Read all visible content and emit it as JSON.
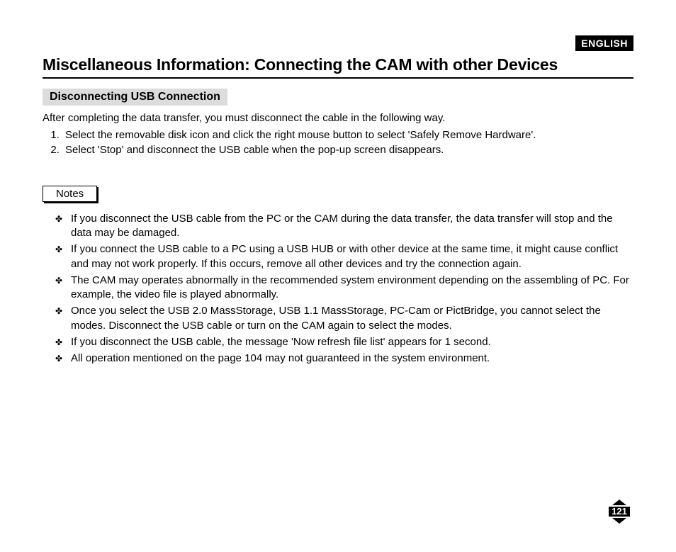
{
  "language_badge": "ENGLISH",
  "title": "Miscellaneous Information: Connecting the CAM with other Devices",
  "section_heading": "Disconnecting USB Connection",
  "intro": "After completing the data transfer, you must disconnect the cable in the following way.",
  "steps": [
    "Select the removable disk icon and click the right mouse button to select 'Safely Remove Hardware'.",
    "Select 'Stop' and disconnect the USB cable when the pop-up screen disappears."
  ],
  "notes_label": "Notes",
  "notes": [
    "If you disconnect the USB cable from the PC or the CAM during the data transfer, the data transfer will stop and the data may be damaged.",
    "If you connect the USB cable to a PC using a USB HUB or with other device at the same time, it might cause conflict and may not work properly. If this occurs, remove all other devices and try the connection again.",
    "The CAM may operates abnormally in the recommended system environment depending on the assembling of PC. For example, the video file is played abnormally.",
    "Once you select the USB 2.0 MassStorage, USB 1.1 MassStorage, PC-Cam or PictBridge, you cannot select the modes. Disconnect the USB cable or turn on the CAM again to select the modes.",
    "If you disconnect the USB cable, the message 'Now refresh file list' appears for 1 second.",
    "All operation mentioned on the page 104 may not guaranteed in the system environment."
  ],
  "page_number": "121"
}
